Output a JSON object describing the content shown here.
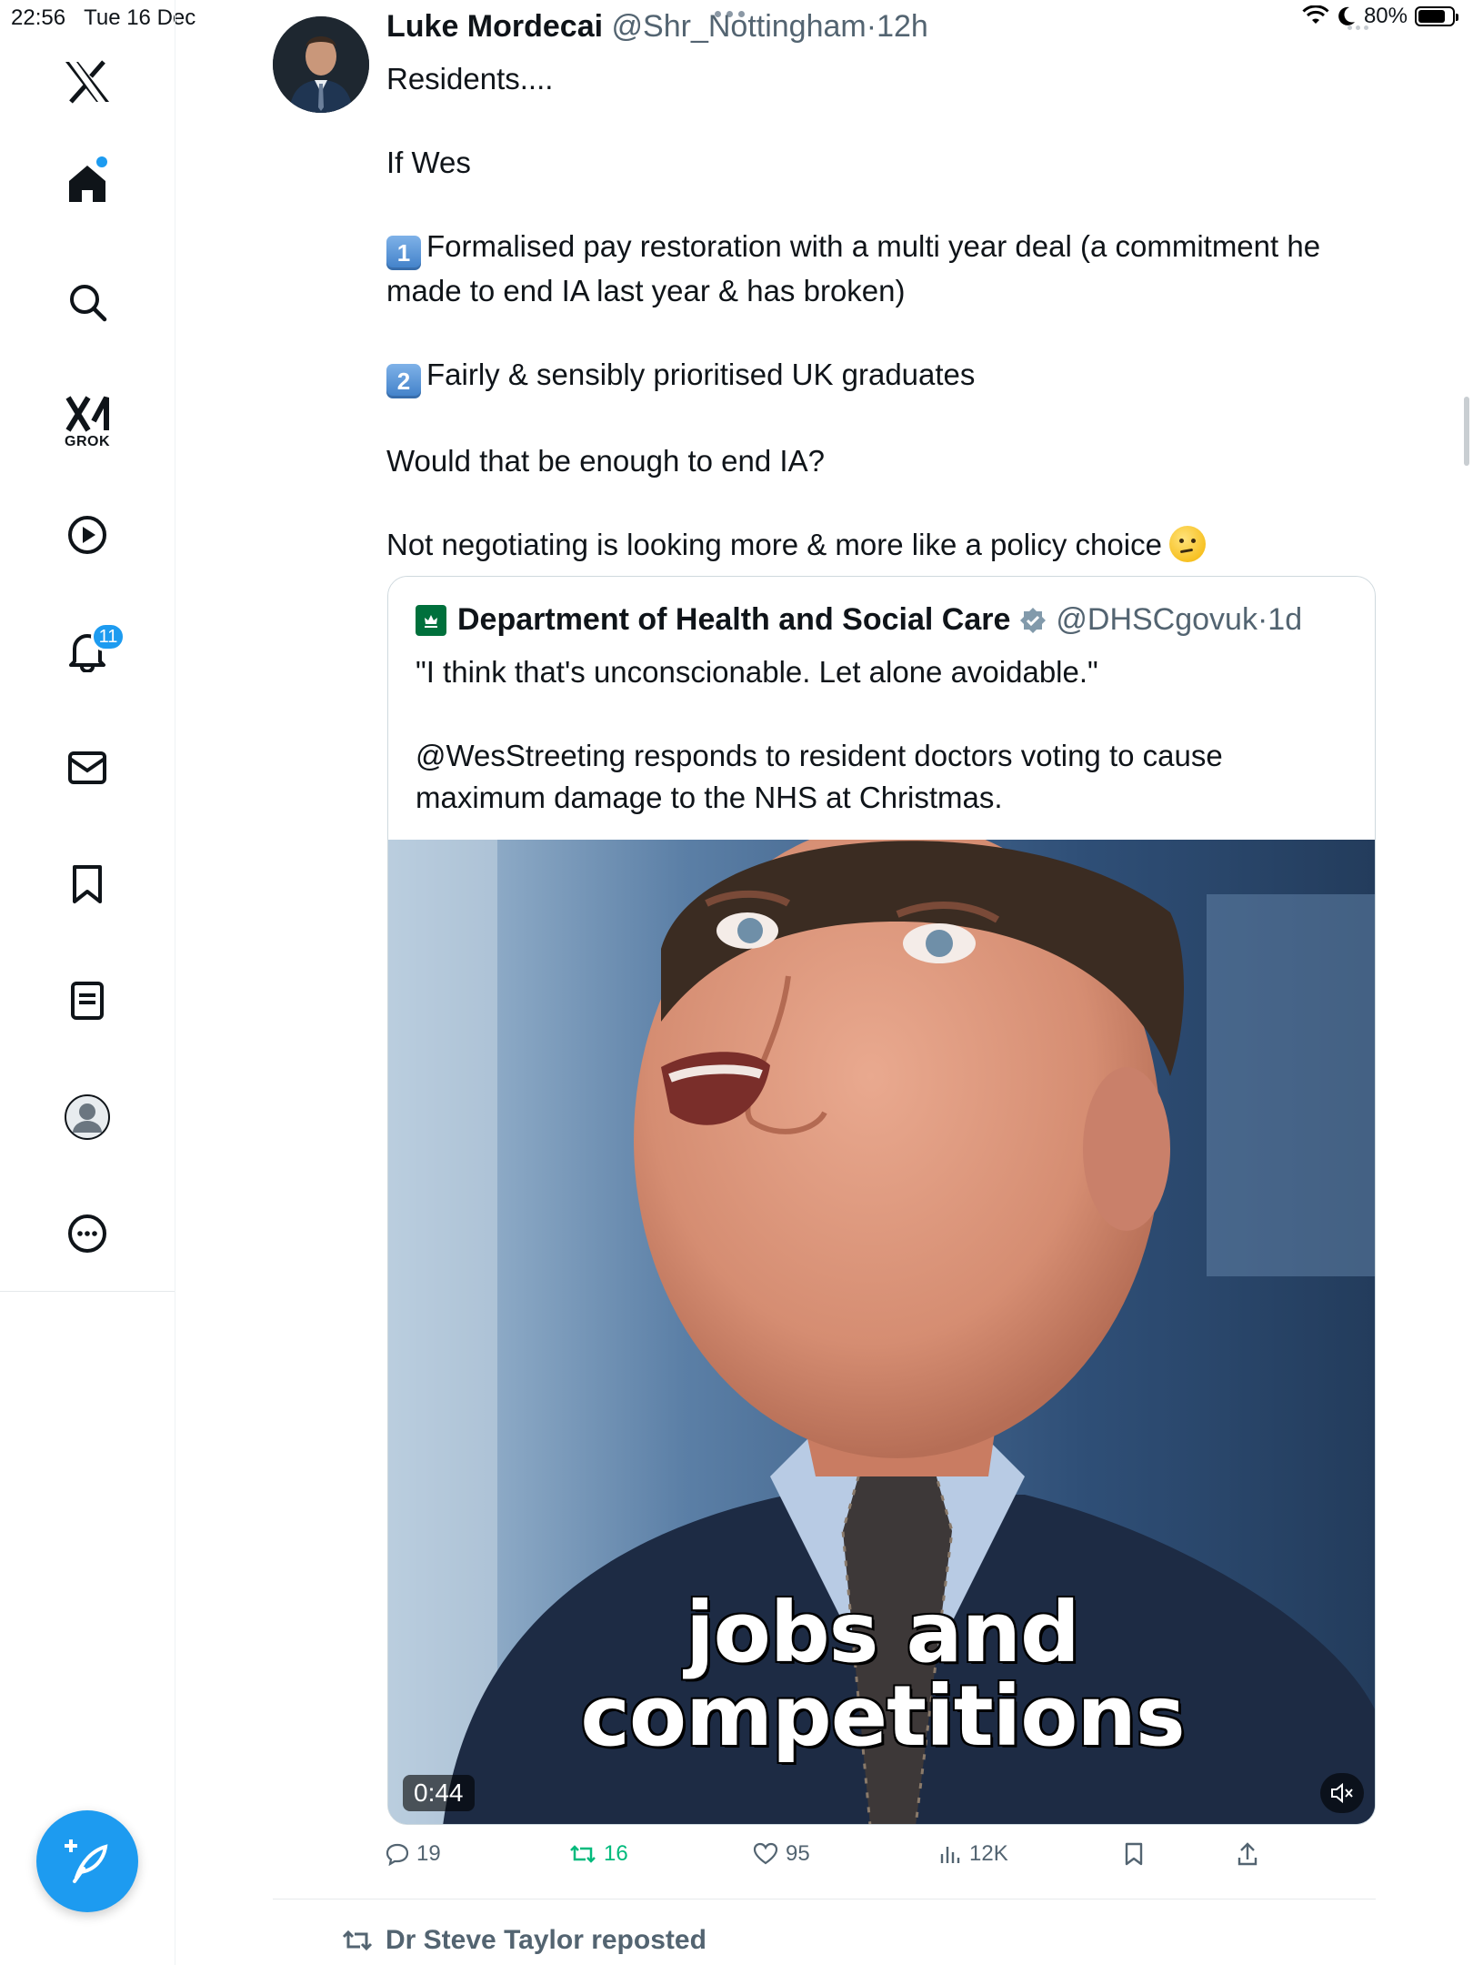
{
  "status_bar": {
    "time": "22:56",
    "date": "Tue 16 Dec",
    "battery": "80%",
    "battery_level": 0.8
  },
  "sidebar": {
    "grok_label": "GROK",
    "notifications_badge": "11"
  },
  "tweet": {
    "author_name": "Luke Mordecai",
    "author_handle": "@Shr_Nottingham",
    "separator": "·",
    "time": "12h",
    "lines": {
      "l1": "Residents....",
      "l2": "If Wes",
      "key1": "1",
      "l3": "Formalised pay restoration with a multi year deal (a commitment he made to end IA last year & has broken)",
      "key2": "2",
      "l4": "Fairly & sensibly prioritised UK graduates",
      "l5": "Would that be enough to end IA?",
      "l6": "Not negotiating is looking more & more like a policy choice"
    }
  },
  "quote": {
    "author_name": "Department of Health and Social Care",
    "author_handle": "@DHSCgovuk",
    "separator": "·",
    "time": "1d",
    "text1": "\"I think that's unconscionable. Let alone avoidable.\"",
    "text2": "@WesStreeting responds to resident doctors voting to cause maximum damage to the NHS at Christmas.",
    "video": {
      "caption_line1": "jobs and",
      "caption_line2": "competitions",
      "duration": "0:44"
    }
  },
  "actions": {
    "replies": "19",
    "reposts": "16",
    "likes": "95",
    "views": "12K"
  },
  "next_item": {
    "repost_label": "Dr Steve Taylor reposted"
  },
  "colors": {
    "accent": "#1d9bf0",
    "repost_green": "#00ba7c",
    "secondary_text": "#536471"
  }
}
